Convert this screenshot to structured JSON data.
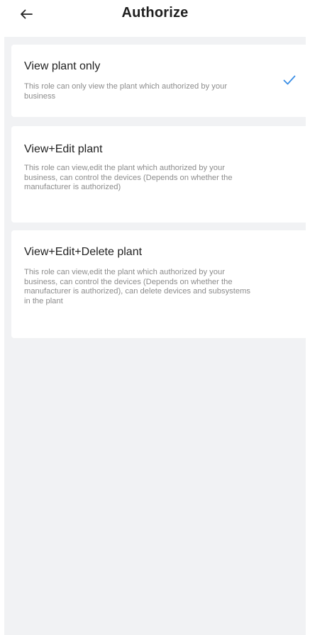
{
  "header": {
    "title": "Authorize",
    "back_icon": "arrow-left-icon"
  },
  "roles": [
    {
      "title": "View plant only",
      "description": "This role can only view the plant which authorized by your business",
      "selected": true
    },
    {
      "title": "View+Edit plant",
      "description": "This role can view,edit the plant which authorized by your business, can control the devices (Depends on whether the manufacturer is authorized)",
      "selected": false
    },
    {
      "title": "View+Edit+Delete plant",
      "description": "This role can view,edit the plant which authorized by your business, can control the devices (Depends on whether the manufacturer is authorized), can delete devices and subsystems in the plant",
      "selected": false
    }
  ],
  "colors": {
    "accent": "#3a8ee6",
    "background": "#f1f2f4"
  }
}
